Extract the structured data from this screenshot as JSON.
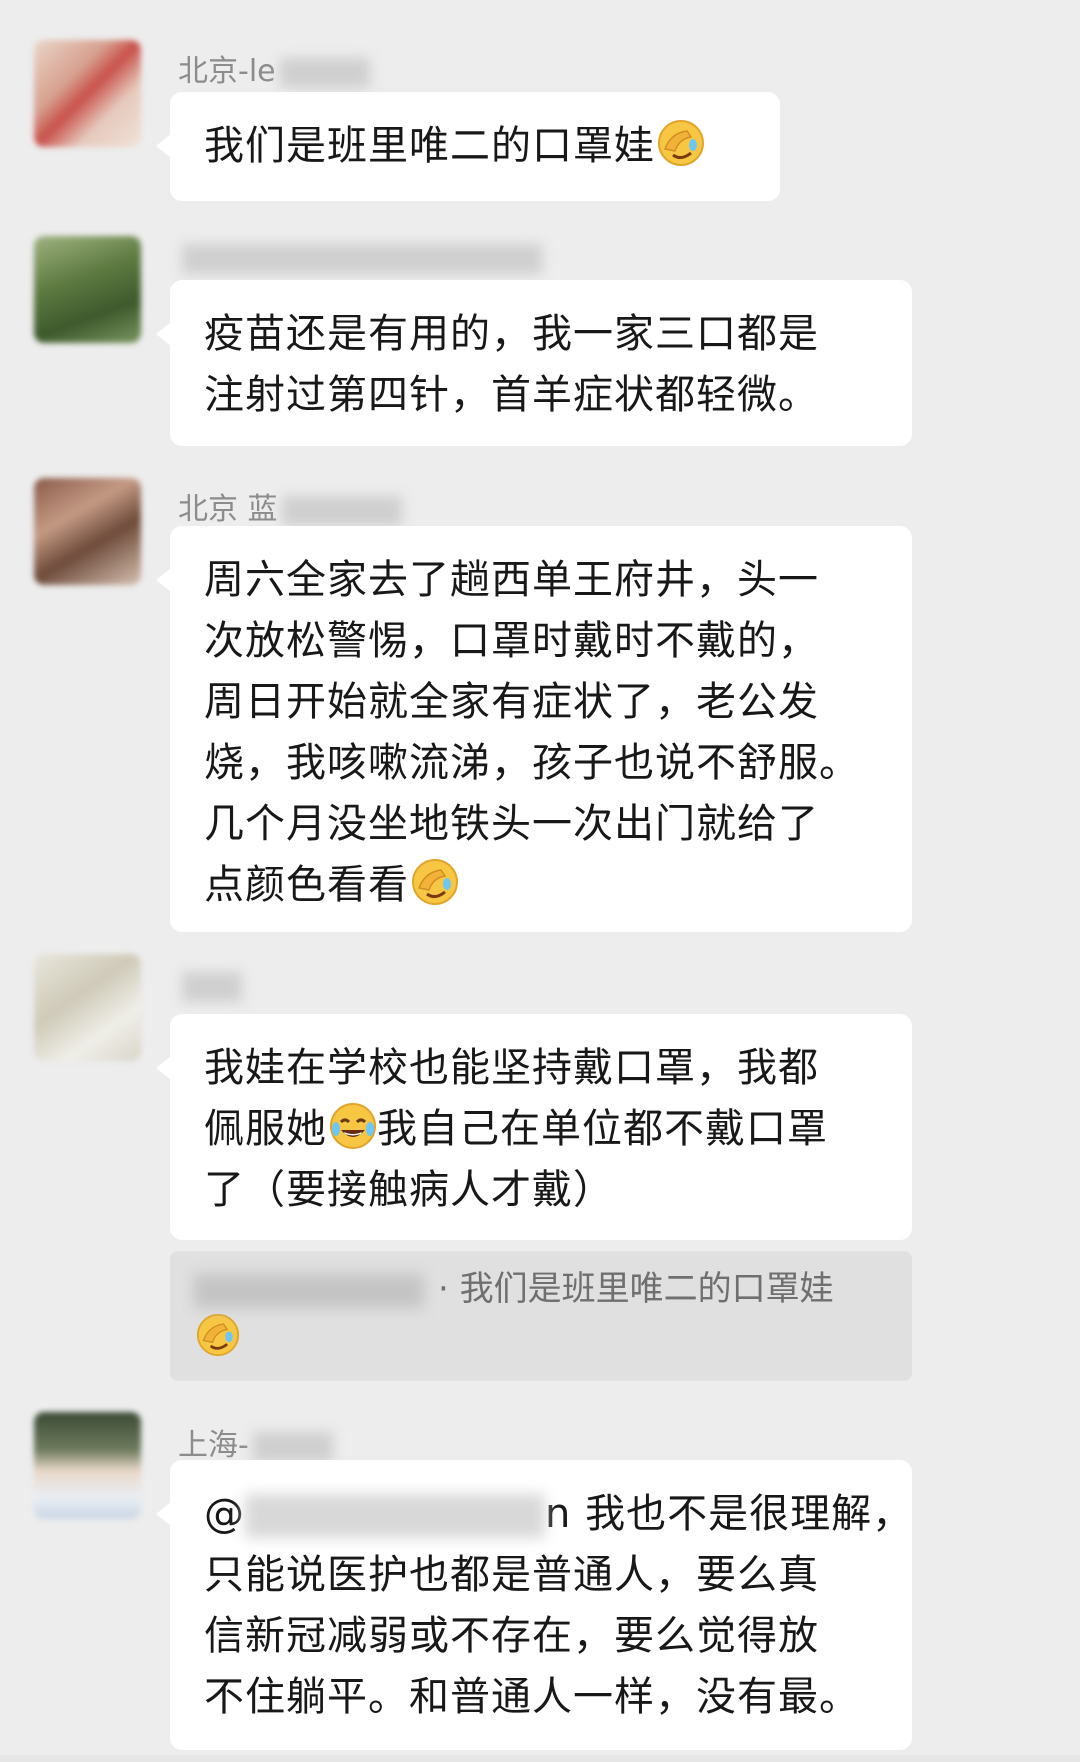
{
  "messages": [
    {
      "sender": "北京-le",
      "lines": [
        "我们是班里唯二的口罩娃"
      ],
      "emoji": "facepalm-laugh-emoji"
    },
    {
      "sender": "",
      "lines": [
        "疫苗还是有用的，我一家三口都是",
        "注射过第四针，首羊症状都轻微。"
      ]
    },
    {
      "sender": "北京 蓝",
      "lines": [
        "周六全家去了趟西单王府井，头一",
        "次放松警惕，口罩时戴时不戴的，",
        "周日开始就全家有症状了，老公发",
        "烧，我咳嗽流涕，孩子也说不舒服。",
        "几个月没坐地铁头一次出门就给了",
        "点颜色看看"
      ],
      "emoji": "facepalm-laugh-emoji"
    },
    {
      "sender": "",
      "lines": [
        "我娃在学校也能坚持戴口罩，我都",
        "佩服她",
        "我自己在单位都不戴口罩",
        "了（要接触病人才戴）"
      ],
      "emoji": "tears-of-joy-emoji"
    },
    {
      "quote_text": "我们是班里唯二的口罩娃",
      "emoji": "facepalm-laugh-emoji"
    },
    {
      "sender": "上海-",
      "mention_prefix": "@",
      "mention_suffix": "n",
      "lines": [
        "我也不是很理解，",
        "只能说医护也都是普通人，要么真",
        "信新冠减弱或不存在，要么觉得放",
        "不住躺平。和普通人一样，没有最。"
      ]
    }
  ],
  "colors": {
    "background": "#ededed",
    "bubble": "#ffffff",
    "quote": "#e0e0e0",
    "sender_text": "#8c8c8c",
    "message_text": "#181818"
  }
}
